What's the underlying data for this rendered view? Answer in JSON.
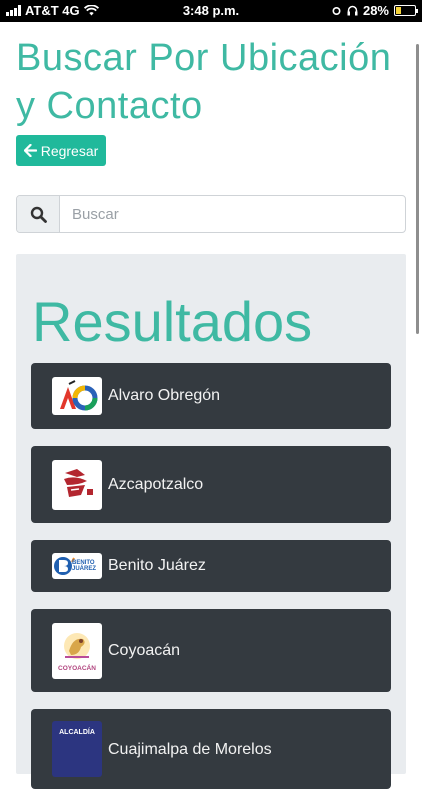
{
  "status_bar": {
    "carrier": "AT&T 4G",
    "time": "3:48 p.m.",
    "battery": "28%"
  },
  "header": {
    "title": "Buscar Por Ubicación y Contacto",
    "back_label": "Regresar"
  },
  "search": {
    "placeholder": "Buscar",
    "value": ""
  },
  "results": {
    "title": "Resultados",
    "items": [
      {
        "label": "Alvaro Obregón",
        "logo": "alvaro-obregon-logo"
      },
      {
        "label": "Azcapotzalco",
        "logo": "azcapotzalco-logo"
      },
      {
        "label": "Benito Juárez",
        "logo": "benito-juarez-logo",
        "logo_text": "BENITO JUÁREZ"
      },
      {
        "label": "Coyoacán",
        "logo": "coyoacan-logo",
        "logo_text": "COYOACÁN"
      },
      {
        "label": "Cuajimalpa de Morelos",
        "logo": "cuajimalpa-logo",
        "logo_text": "ALCALDÍA"
      }
    ]
  },
  "colors": {
    "accent": "#3fb9a3",
    "button": "#20b99b",
    "item_bg": "#343a40",
    "panel_bg": "#e9ecef"
  }
}
